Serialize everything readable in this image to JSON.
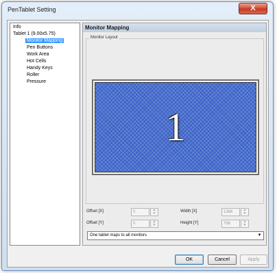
{
  "window": {
    "title": "PenTablet Setting",
    "close_glyph": "X"
  },
  "tree": {
    "items": [
      {
        "label": "Info",
        "level": 0
      },
      {
        "label": "Tablet 1 (9.00x5.75)",
        "level": 0
      },
      {
        "label": "Monitor Mapping",
        "level": 1,
        "selected": true
      },
      {
        "label": "Pen Buttons",
        "level": 1
      },
      {
        "label": "Work Area",
        "level": 1
      },
      {
        "label": "Hot Cells",
        "level": 1
      },
      {
        "label": "Handy Keys",
        "level": 1
      },
      {
        "label": "Roller",
        "level": 1
      },
      {
        "label": "Pressure",
        "level": 1
      }
    ]
  },
  "panel": {
    "header": "Monitor Mapping",
    "group_label": "Monitor Layout",
    "monitor_number": "1",
    "offset_x_label": "Offset [X]",
    "offset_y_label": "Offset [Y]",
    "width_label": "Width [X]",
    "height_label": "Height [Y]",
    "offset_x_value": "0",
    "offset_y_value": "0",
    "width_value": "1366",
    "height_value": "768",
    "mapping_select": "One tablet maps to all monitors"
  },
  "buttons": {
    "ok": "OK",
    "cancel": "Cancel",
    "apply": "Apply"
  },
  "colors": {
    "selection": "#3399ff",
    "monitor_fill": "#3d64c8",
    "close_button": "#d14a33"
  }
}
